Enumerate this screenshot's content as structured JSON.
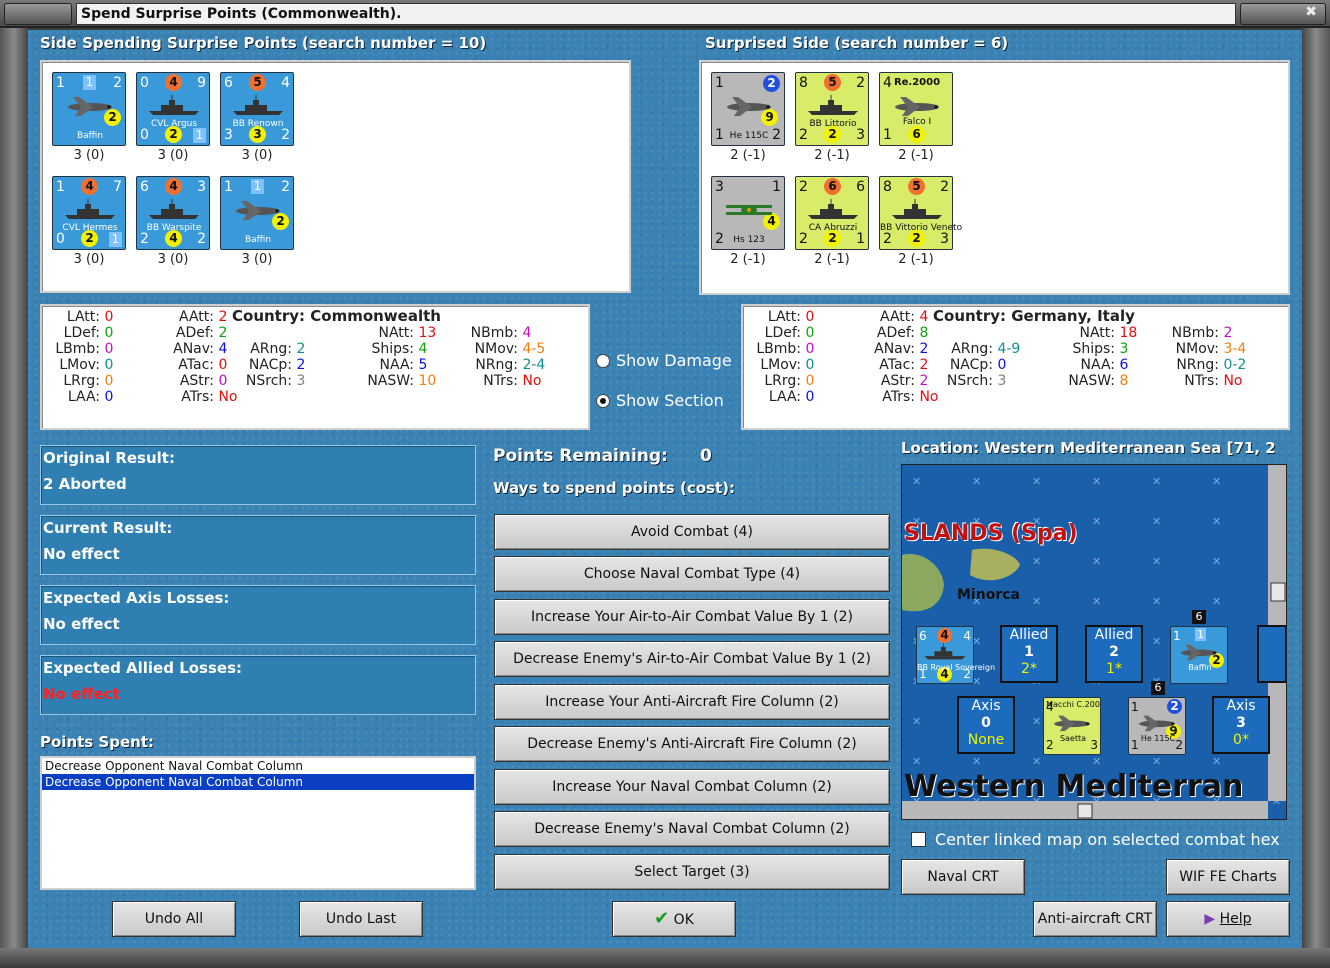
{
  "window": {
    "title": "Spend Surprise Points (Commonwealth)."
  },
  "left": {
    "header": "Side Spending Surprise Points (search number = 10)",
    "units": [
      {
        "tl": "1",
        "sq": "1",
        "tr": "2",
        "circ": "2",
        "circ_color": "yel",
        "name": "Baffin",
        "caption": "3 (0)",
        "bl": "",
        "color": "blue",
        "type": "plane"
      },
      {
        "tl": "0",
        "circ_top": "4",
        "tr": "9",
        "name": "CVL Argus",
        "bl": "0",
        "circ_bot": "2",
        "sq": "1",
        "caption": "3 (0)",
        "color": "blue",
        "type": "ship"
      },
      {
        "tl": "6",
        "circ_top": "5",
        "tr": "4",
        "name": "BB Renown",
        "bl": "3",
        "circ_bot": "3",
        "br": "2",
        "caption": "3 (0)",
        "color": "blue",
        "type": "ship"
      },
      {
        "tl": "1",
        "circ_top": "4",
        "tr": "7",
        "name": "CVL Hermes",
        "bl": "0",
        "circ_bot": "2",
        "sq": "1",
        "caption": "3 (0)",
        "color": "blue",
        "type": "ship"
      },
      {
        "tl": "6",
        "circ_top": "4",
        "tr": "3",
        "name": "BB Warspite",
        "bl": "2",
        "circ_bot": "4",
        "br": "2",
        "caption": "3 (0)",
        "color": "blue",
        "type": "ship"
      },
      {
        "tl": "1",
        "sq": "1",
        "tr": "2",
        "circ": "2",
        "circ_color": "yel",
        "name": "Baffin",
        "caption": "3 (0)",
        "color": "blue",
        "type": "plane"
      }
    ],
    "stats": {
      "col1": [
        [
          "LAtt:",
          "0"
        ],
        [
          "LDef:",
          "0"
        ],
        [
          "LBmb:",
          "0"
        ],
        [
          "LMov:",
          "0"
        ],
        [
          "LRrg:",
          "0"
        ],
        [
          "LAA:",
          "0"
        ]
      ],
      "col2": [
        [
          "AAtt:",
          "2"
        ],
        [
          "ADef:",
          "2"
        ],
        [
          "ANav:",
          "4"
        ],
        [
          "ATac:",
          "0"
        ],
        [
          "AStr:",
          "0"
        ],
        [
          "ATrs:",
          "No"
        ]
      ],
      "country_label": "Country:",
      "country": "Commonwealth",
      "col3": [
        [
          "ARng:",
          "2"
        ],
        [
          "NACp:",
          "2"
        ],
        [
          "NSrch:",
          "3"
        ]
      ],
      "col4": [
        [
          "NAtt:",
          "13"
        ],
        [
          "Ships:",
          "4"
        ],
        [
          "NAA:",
          "5"
        ],
        [
          "NASW:",
          "10"
        ]
      ],
      "col5": [
        [
          "NBmb:",
          "4"
        ],
        [
          "NMov:",
          "4-5"
        ],
        [
          "NRng:",
          "2-4"
        ],
        [
          "NTrs:",
          "No"
        ]
      ]
    }
  },
  "right": {
    "header": "Surprised Side (search number = 6)",
    "units": [
      {
        "tl": "1",
        "circ": "2",
        "circ_color": "dblue",
        "circ2": "9",
        "name": "He 115C",
        "bl": "1",
        "br": "2",
        "caption": "2 (-1)",
        "color": "gray",
        "type": "plane"
      },
      {
        "tl": "8",
        "circ_top": "5",
        "tr": "2",
        "name": "BB Littorio",
        "bl": "2",
        "circ_bot": "2",
        "br": "3",
        "caption": "2 (-1)",
        "color": "yellow",
        "type": "ship"
      },
      {
        "tl": "4",
        "name_top": "Re.2000",
        "name": "Falco I",
        "bl": "1",
        "circ_bot": "6",
        "caption": "2 (-1)",
        "color": "yellow",
        "type": "plane"
      },
      {
        "tl": "3",
        "tr": "1",
        "circ": "4",
        "circ_color": "yel",
        "name": "Hs 123",
        "bl": "2",
        "caption": "2 (-1)",
        "color": "gray",
        "type": "biplane"
      },
      {
        "tl": "2",
        "circ_top": "6",
        "tr": "6",
        "name": "CA Abruzzi",
        "bl": "2",
        "circ_bot": "2",
        "br": "1",
        "caption": "2 (-1)",
        "color": "yellow",
        "type": "ship"
      },
      {
        "tl": "8",
        "circ_top": "5",
        "tr": "2",
        "name": "BB Vittorio Veneto",
        "bl": "2",
        "circ_bot": "2",
        "br": "3",
        "caption": "2 (-1)",
        "color": "yellow",
        "type": "ship"
      }
    ],
    "stats": {
      "col1": [
        [
          "LAtt:",
          "0"
        ],
        [
          "LDef:",
          "0"
        ],
        [
          "LBmb:",
          "0"
        ],
        [
          "LMov:",
          "0"
        ],
        [
          "LRrg:",
          "0"
        ],
        [
          "LAA:",
          "0"
        ]
      ],
      "col2": [
        [
          "AAtt:",
          "4"
        ],
        [
          "ADef:",
          "8"
        ],
        [
          "ANav:",
          "2"
        ],
        [
          "ATac:",
          "2"
        ],
        [
          "AStr:",
          "2"
        ],
        [
          "ATrs:",
          "No"
        ]
      ],
      "country_label": "Country:",
      "country": "Germany, Italy",
      "col3": [
        [
          "ARng:",
          "4-9"
        ],
        [
          "NACp:",
          "0"
        ],
        [
          "NSrch:",
          "3"
        ]
      ],
      "col4": [
        [
          "NAtt:",
          "18"
        ],
        [
          "Ships:",
          "3"
        ],
        [
          "NAA:",
          "6"
        ],
        [
          "NASW:",
          "8"
        ]
      ],
      "col5": [
        [
          "NBmb:",
          "2"
        ],
        [
          "NMov:",
          "3-4"
        ],
        [
          "NRng:",
          "0-2"
        ],
        [
          "NTrs:",
          "No"
        ]
      ]
    }
  },
  "view_options": {
    "show_damage": "Show Damage",
    "show_section": "Show Section",
    "selected": "show_section"
  },
  "results": [
    {
      "label": "Original Result:",
      "value": "2 Aborted",
      "value_color": "#ffffff"
    },
    {
      "label": "Current Result:",
      "value": "No effect",
      "value_color": "#ffffff"
    },
    {
      "label": "Expected Axis Losses:",
      "value": "No effect",
      "value_color": "#ffffff"
    },
    {
      "label": "Expected Allied Losses:",
      "value": "No effect",
      "value_color": "#ff2020"
    }
  ],
  "points_spent": {
    "label": "Points Spent:",
    "items": [
      "Decrease Opponent Naval Combat Column",
      "Decrease Opponent Naval Combat Column"
    ],
    "selected_index": 1
  },
  "points_remaining": {
    "label": "Points Remaining:",
    "value": "0"
  },
  "ways_label": "Ways to spend points (cost):",
  "ways": [
    "Avoid Combat (4)",
    "Choose Naval Combat Type (4)",
    "Increase Your Air-to-Air Combat Value By 1 (2)",
    "Decrease Enemy's Air-to-Air Combat Value By 1 (2)",
    "Increase Your Anti-Aircraft Fire Column (2)",
    "Decrease Enemy's Anti-Aircraft Fire Column (2)",
    "Increase Your Naval Combat Column (2)",
    "Decrease Enemy's Naval Combat Column (2)",
    "Select Target (3)"
  ],
  "location": {
    "label": "Location: Western Mediterranean Sea [71, 2",
    "map_islands": "SLANDS (Spa)",
    "map_minorca": "Minorca",
    "map_sea": "Western Mediterran",
    "allied1": {
      "t": "Allied",
      "n": "1",
      "s": "2*"
    },
    "allied2": {
      "t": "Allied",
      "n": "2",
      "s": "1*"
    },
    "axis1": {
      "t": "Axis",
      "n": "0",
      "s": "None"
    },
    "axis2": {
      "t": "Axis",
      "n": "3",
      "s": "0*"
    },
    "stack_count_a": "6",
    "stack_count_b": "6"
  },
  "map_units": {
    "rs": {
      "tl": "6",
      "circ_top": "4",
      "tr": "4",
      "name": "BB Royal Sovereign",
      "bl": "1",
      "circ_bot": "4",
      "br": "2"
    },
    "baffin": {
      "tl": "1",
      "sq": "1",
      "circ": "2",
      "name": "Baffin"
    },
    "macchi": {
      "tl": "4",
      "name_top": "Macchi C.200",
      "name": "Saetta",
      "bl": "2",
      "br": "3"
    },
    "he115": {
      "tl": "1",
      "circ": "2",
      "circ2": "9",
      "name": "He 115C",
      "bl": "1",
      "br": "2"
    }
  },
  "center_linked": {
    "label": "Center linked map on selected combat hex",
    "checked": false
  },
  "buttons": {
    "undo_all": "Undo All",
    "undo_last": "Undo Last",
    "ok": "OK",
    "naval_crt": "Naval CRT",
    "wif_fe_charts": "WIF FE Charts",
    "aa_crt": "Anti-aircraft CRT",
    "help": "Help"
  },
  "colors": {
    "panel_blue": "#3a82b4",
    "red_value": "#e01010",
    "blue_value": "#1010e0",
    "green_value": "#10a010",
    "purple_value": "#c010c0",
    "orange_value": "#f08010",
    "teal_value": "#109090",
    "gray_value": "#808080"
  }
}
